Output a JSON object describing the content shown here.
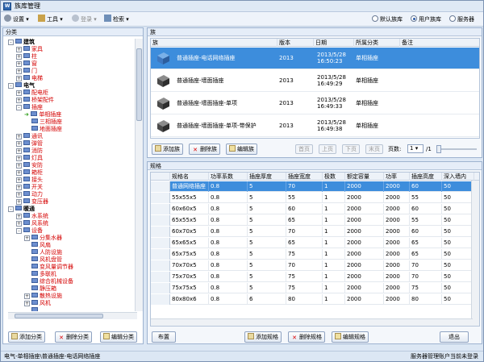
{
  "window": {
    "title": "族库管理",
    "icon": "app-icon"
  },
  "toolbar": {
    "settings": "设置",
    "tools": "工具",
    "login": "登录",
    "check": "检索",
    "lib_default": "默认族库",
    "lib_user": "用户族库",
    "lib_server": "服务器",
    "lib_selected": "用户族库"
  },
  "left": {
    "header": "分类",
    "tree": [
      {
        "label": "建筑",
        "level": 0,
        "toggle": "-",
        "bold": true
      },
      {
        "label": "家具",
        "level": 2,
        "toggle": "+",
        "red": true
      },
      {
        "label": "柱",
        "level": 2,
        "toggle": "+",
        "red": true
      },
      {
        "label": "窗",
        "level": 2,
        "toggle": "+",
        "red": true
      },
      {
        "label": "门",
        "level": 2,
        "toggle": "+",
        "red": true
      },
      {
        "label": "电梯",
        "level": 2,
        "toggle": "+",
        "red": true
      },
      {
        "label": "电气",
        "level": 0,
        "toggle": "-",
        "bold": true
      },
      {
        "label": "配电柜",
        "level": 2,
        "toggle": "+",
        "red": true
      },
      {
        "label": "桥架配件",
        "level": 2,
        "toggle": "+",
        "red": true
      },
      {
        "label": "插座",
        "level": 2,
        "toggle": "-",
        "red": true
      },
      {
        "label": "单相插座",
        "level": 4,
        "toggle": "",
        "red": true,
        "arrow": true
      },
      {
        "label": "三相插座",
        "level": 4,
        "toggle": "",
        "red": true
      },
      {
        "label": "地面插座",
        "level": 4,
        "toggle": "",
        "red": true
      },
      {
        "label": "通讯",
        "level": 2,
        "toggle": "+",
        "red": true
      },
      {
        "label": "弹管",
        "level": 2,
        "toggle": "+",
        "red": true
      },
      {
        "label": "消防",
        "level": 2,
        "toggle": "+",
        "red": true
      },
      {
        "label": "灯具",
        "level": 2,
        "toggle": "+",
        "red": true
      },
      {
        "label": "安防",
        "level": 2,
        "toggle": "+",
        "red": true
      },
      {
        "label": "箱柜",
        "level": 2,
        "toggle": "+",
        "red": true
      },
      {
        "label": "接头",
        "level": 2,
        "toggle": "+",
        "red": true
      },
      {
        "label": "开关",
        "level": 2,
        "toggle": "+",
        "red": true
      },
      {
        "label": "动力",
        "level": 2,
        "toggle": "+",
        "red": true
      },
      {
        "label": "变压器",
        "level": 2,
        "toggle": "+",
        "red": true
      },
      {
        "label": "暖通",
        "level": 0,
        "toggle": "-",
        "bold": true
      },
      {
        "label": "水系统",
        "level": 2,
        "toggle": "+",
        "red": true
      },
      {
        "label": "风系统",
        "level": 2,
        "toggle": "+",
        "red": true
      },
      {
        "label": "设备",
        "level": 2,
        "toggle": "-",
        "red": true
      },
      {
        "label": "分集水器",
        "level": 4,
        "toggle": "+",
        "red": true
      },
      {
        "label": "风扇",
        "level": 4,
        "toggle": "",
        "red": true
      },
      {
        "label": "人防设施",
        "level": 4,
        "toggle": "",
        "red": true
      },
      {
        "label": "风机盘管",
        "level": 4,
        "toggle": "",
        "red": true
      },
      {
        "label": "变风量调节器",
        "level": 4,
        "toggle": "",
        "red": true
      },
      {
        "label": "多联机",
        "level": 4,
        "toggle": "",
        "red": true
      },
      {
        "label": "综合机械设备",
        "level": 4,
        "toggle": "",
        "red": true
      },
      {
        "label": "静压箱",
        "level": 4,
        "toggle": "",
        "red": true
      },
      {
        "label": "散热设施",
        "level": 4,
        "toggle": "+",
        "red": true
      },
      {
        "label": "风机",
        "level": 4,
        "toggle": "+",
        "red": true
      },
      {
        "label": "…",
        "level": 4,
        "toggle": "",
        "red": true
      }
    ],
    "add_btn": "添加分类",
    "del_btn": "删除分类",
    "edit_btn": "编辑分类"
  },
  "family": {
    "header": "族",
    "columns": [
      "族",
      "版本",
      "日期",
      "所属分类",
      "备注"
    ],
    "rows": [
      {
        "name": "普通插座-电话网络插座",
        "ver": "2013",
        "date1": "2013/5/28",
        "date2": "16:50:23",
        "cat": "单相插座",
        "sel": true
      },
      {
        "name": "普通插座-墙面插座",
        "ver": "2013",
        "date1": "2013/5/28",
        "date2": "16:49:29",
        "cat": "单相插座",
        "sel": false
      },
      {
        "name": "普通插座-墙面插座-单项",
        "ver": "2013",
        "date1": "2013/5/28",
        "date2": "16:49:33",
        "cat": "单相插座",
        "sel": false
      },
      {
        "name": "普通插座-墙面插座-单项-带保护",
        "ver": "2013",
        "date1": "2013/5/28",
        "date2": "16:49:38",
        "cat": "单相插座",
        "sel": false
      }
    ],
    "add_btn": "添加族",
    "del_btn": "删除族",
    "edit_btn": "编辑族",
    "first": "首页",
    "prev": "上页",
    "next": "下页",
    "last": "末页",
    "pages_label": "页数:",
    "page_current": "1",
    "page_total": "/1"
  },
  "spec": {
    "header": "规格",
    "columns": [
      "规格名",
      "功率系数",
      "插座厚度",
      "插座宽度",
      "极数",
      "额定容量",
      "功率",
      "插座高度",
      "深入墙内"
    ],
    "rows": [
      [
        "普通网络插座",
        "0.8",
        "5",
        "70",
        "1",
        "2000",
        "2000",
        "60",
        "50"
      ],
      [
        "55x55x5",
        "0.8",
        "5",
        "55",
        "1",
        "2000",
        "2000",
        "55",
        "50"
      ],
      [
        "60x60x5",
        "0.8",
        "5",
        "60",
        "1",
        "2000",
        "2000",
        "60",
        "50"
      ],
      [
        "65x55x5",
        "0.8",
        "5",
        "65",
        "1",
        "2000",
        "2000",
        "55",
        "50"
      ],
      [
        "60x70x5",
        "0.8",
        "5",
        "70",
        "1",
        "2000",
        "2000",
        "60",
        "50"
      ],
      [
        "65x65x5",
        "0.8",
        "5",
        "65",
        "1",
        "2000",
        "2000",
        "65",
        "50"
      ],
      [
        "65x75x5",
        "0.8",
        "5",
        "75",
        "1",
        "2000",
        "2000",
        "65",
        "50"
      ],
      [
        "70x70x5",
        "0.8",
        "5",
        "70",
        "1",
        "2000",
        "2000",
        "70",
        "50"
      ],
      [
        "75x70x5",
        "0.8",
        "5",
        "75",
        "1",
        "2000",
        "2000",
        "70",
        "50"
      ],
      [
        "75x75x5",
        "0.8",
        "5",
        "75",
        "1",
        "2000",
        "2000",
        "75",
        "50"
      ],
      [
        "80x80x6",
        "0.8",
        "6",
        "80",
        "1",
        "2000",
        "2000",
        "80",
        "50"
      ]
    ],
    "layout_btn": "布置",
    "add_btn": "添加规格",
    "del_btn": "删除规格",
    "edit_btn": "编辑规格",
    "exit_btn": "退出"
  },
  "status": {
    "left": "电气-单相插座\\普通插座-电话网络插座",
    "right": "服务器管理账户当前未登录"
  }
}
